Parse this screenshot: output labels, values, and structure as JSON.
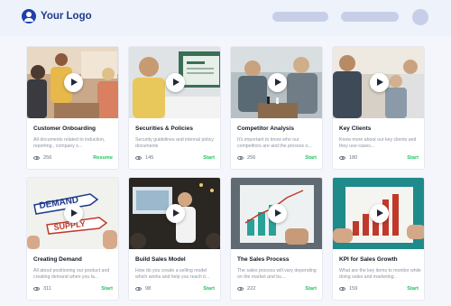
{
  "header": {
    "logo_text": "Your Logo"
  },
  "courses": [
    {
      "title": "Customer Onboarding",
      "description": "All documents related to induction, reporting , company s...",
      "views": "256",
      "action": "Resume",
      "thumb_icon": "people-meeting-image"
    },
    {
      "title": "Securities & Policies",
      "description": "Security guidelines and internal policy documents",
      "views": "145",
      "action": "Start",
      "thumb_icon": "policy-screen-image"
    },
    {
      "title": "Competitor Analysis",
      "description": "It's important to know who our competitors are and the process o...",
      "views": "256",
      "action": "Start",
      "thumb_icon": "chess-players-image"
    },
    {
      "title": "Key Clients",
      "description": "Know more about our key clients and they use-cases...",
      "views": "180",
      "action": "Start",
      "thumb_icon": "colleagues-image"
    },
    {
      "title": "Creating Demand",
      "description": "All about positioning our product and creating demand when you la...",
      "views": "311",
      "action": "Start",
      "thumb_icon": "demand-supply-drawing-image"
    },
    {
      "title": "Build Sales Model",
      "description": "How do you create a selling model which works and help you reach it...",
      "views": "98",
      "action": "Start",
      "thumb_icon": "presenter-image"
    },
    {
      "title": "The Sales Process",
      "description": "The sales process will vary depending on the market and bu...",
      "views": "222",
      "action": "Start",
      "thumb_icon": "growth-chart-image"
    },
    {
      "title": "KPI for Sales Growth",
      "description": "What are the key items to monitor while doing sales and marketing...",
      "views": "159",
      "action": "Start",
      "thumb_icon": "bar-chart-paper-image"
    }
  ],
  "colors": {
    "brand": "#1e40af",
    "action": "#22c55e",
    "background": "#f4f6fb"
  }
}
